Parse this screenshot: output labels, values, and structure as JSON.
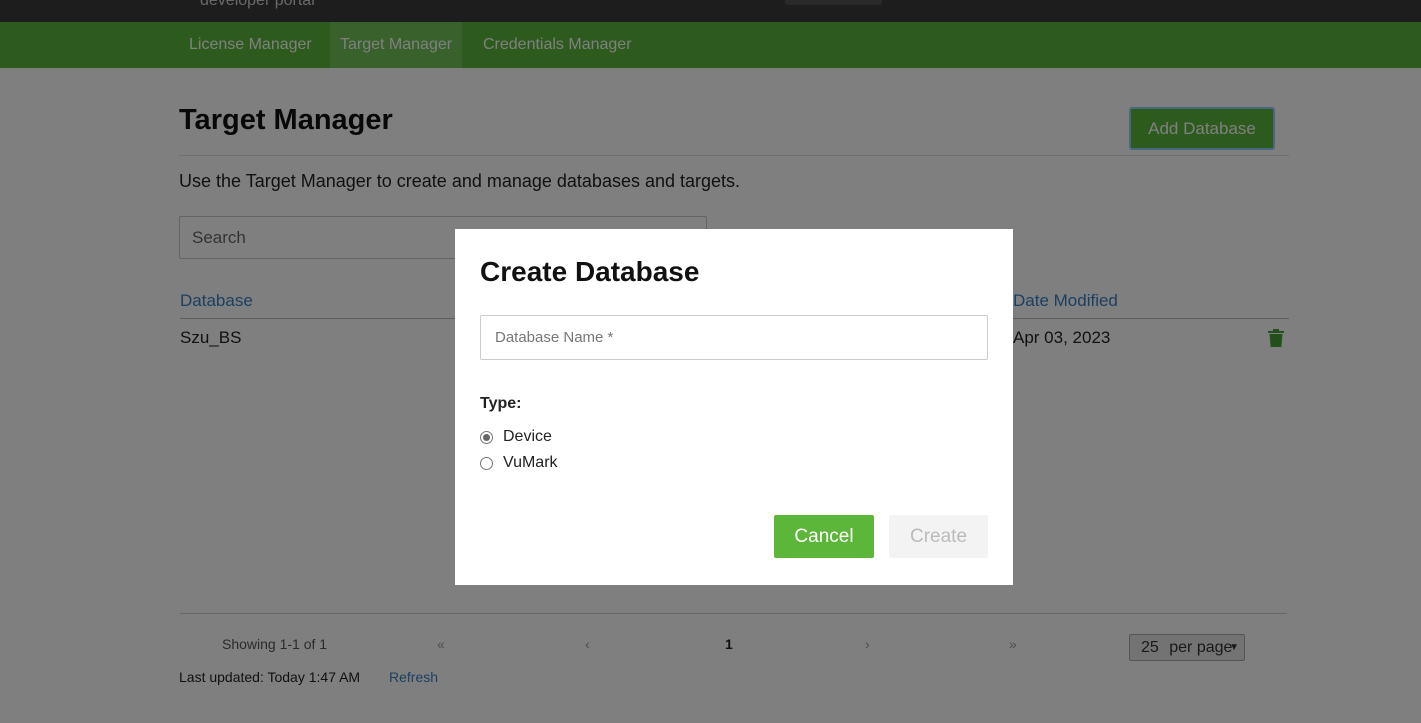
{
  "topbar": {
    "portal_text": "developer portal"
  },
  "nav": {
    "tabs": [
      {
        "label": "License Manager",
        "active": false
      },
      {
        "label": "Target Manager",
        "active": true
      },
      {
        "label": "Credentials Manager",
        "active": false
      }
    ]
  },
  "page": {
    "title": "Target Manager",
    "add_button": "Add Database",
    "description": "Use the Target Manager to create and manage databases and targets.",
    "search_placeholder": "Search"
  },
  "table": {
    "headers": {
      "database": "Database",
      "date_modified": "Date Modified"
    },
    "rows": [
      {
        "database": "Szu_BS",
        "date_modified": "Apr 03, 2023",
        "action_icon": "trash-icon"
      }
    ]
  },
  "footer": {
    "showing": "Showing 1-1 of 1",
    "first": "«",
    "prev": "‹",
    "current_page": "1",
    "next": "›",
    "last": "»",
    "per_page_value": "25",
    "per_page_label": "per page",
    "last_updated": "Last updated: Today 1:47 AM",
    "refresh": "Refresh"
  },
  "modal": {
    "title": "Create Database",
    "name_placeholder": "Database Name *",
    "type_label": "Type:",
    "options": [
      {
        "label": "Device",
        "checked": true
      },
      {
        "label": "VuMark",
        "checked": false
      }
    ],
    "cancel_label": "Cancel",
    "create_label": "Create"
  },
  "colors": {
    "brand_green": "#5bb63a",
    "link_blue": "#3680c5",
    "topbar": "#3a3a3a"
  }
}
